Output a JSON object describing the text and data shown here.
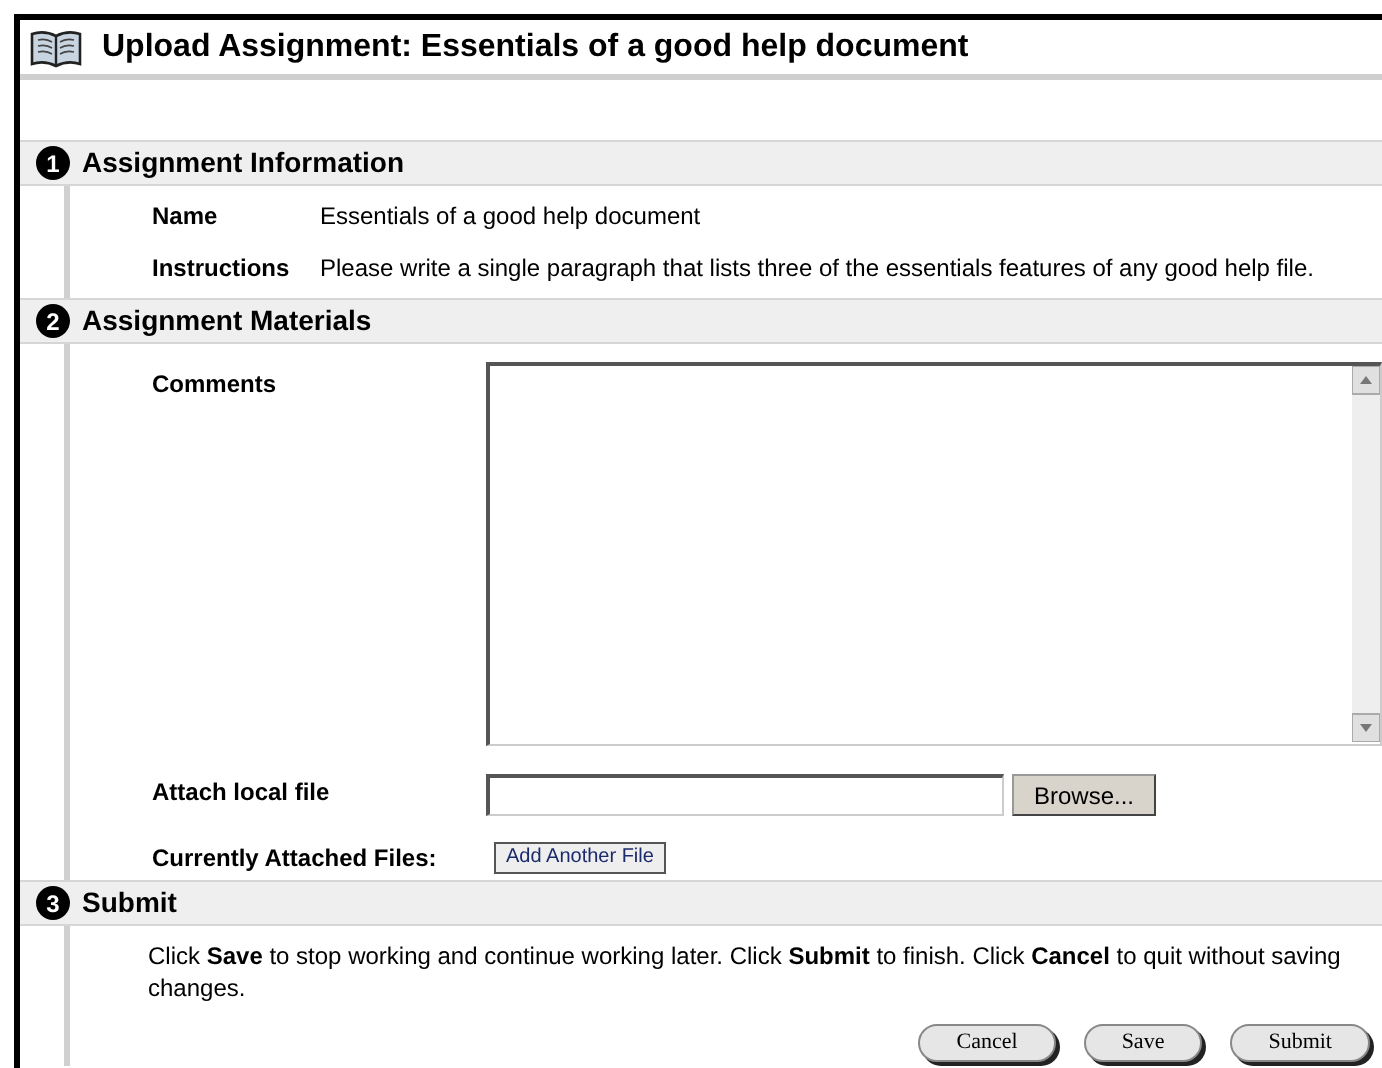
{
  "title": "Upload Assignment: Essentials of a good help document",
  "sections": [
    {
      "number": "1",
      "title": "Assignment Information",
      "kind": "info",
      "rows": [
        {
          "label": "Name",
          "value": "Essentials of a good help document"
        },
        {
          "label": "Instructions",
          "value": "Please write a single paragraph that lists three of the essentials features of any good help file."
        }
      ]
    },
    {
      "number": "2",
      "title": "Assignment Materials",
      "kind": "materials",
      "comments_label": "Comments",
      "attach_label": "Attach local file",
      "browse_button": "Browse...",
      "attached_label": "Currently Attached Files:",
      "add_button": "Add Another File"
    },
    {
      "number": "3",
      "title": "Submit",
      "kind": "submit",
      "text": "Click **Save** to stop working and continue working later. Click **Submit** to finish. Click **Cancel** to quit without saving changes.",
      "buttons": [
        "Cancel",
        "Save",
        "Submit"
      ]
    }
  ]
}
